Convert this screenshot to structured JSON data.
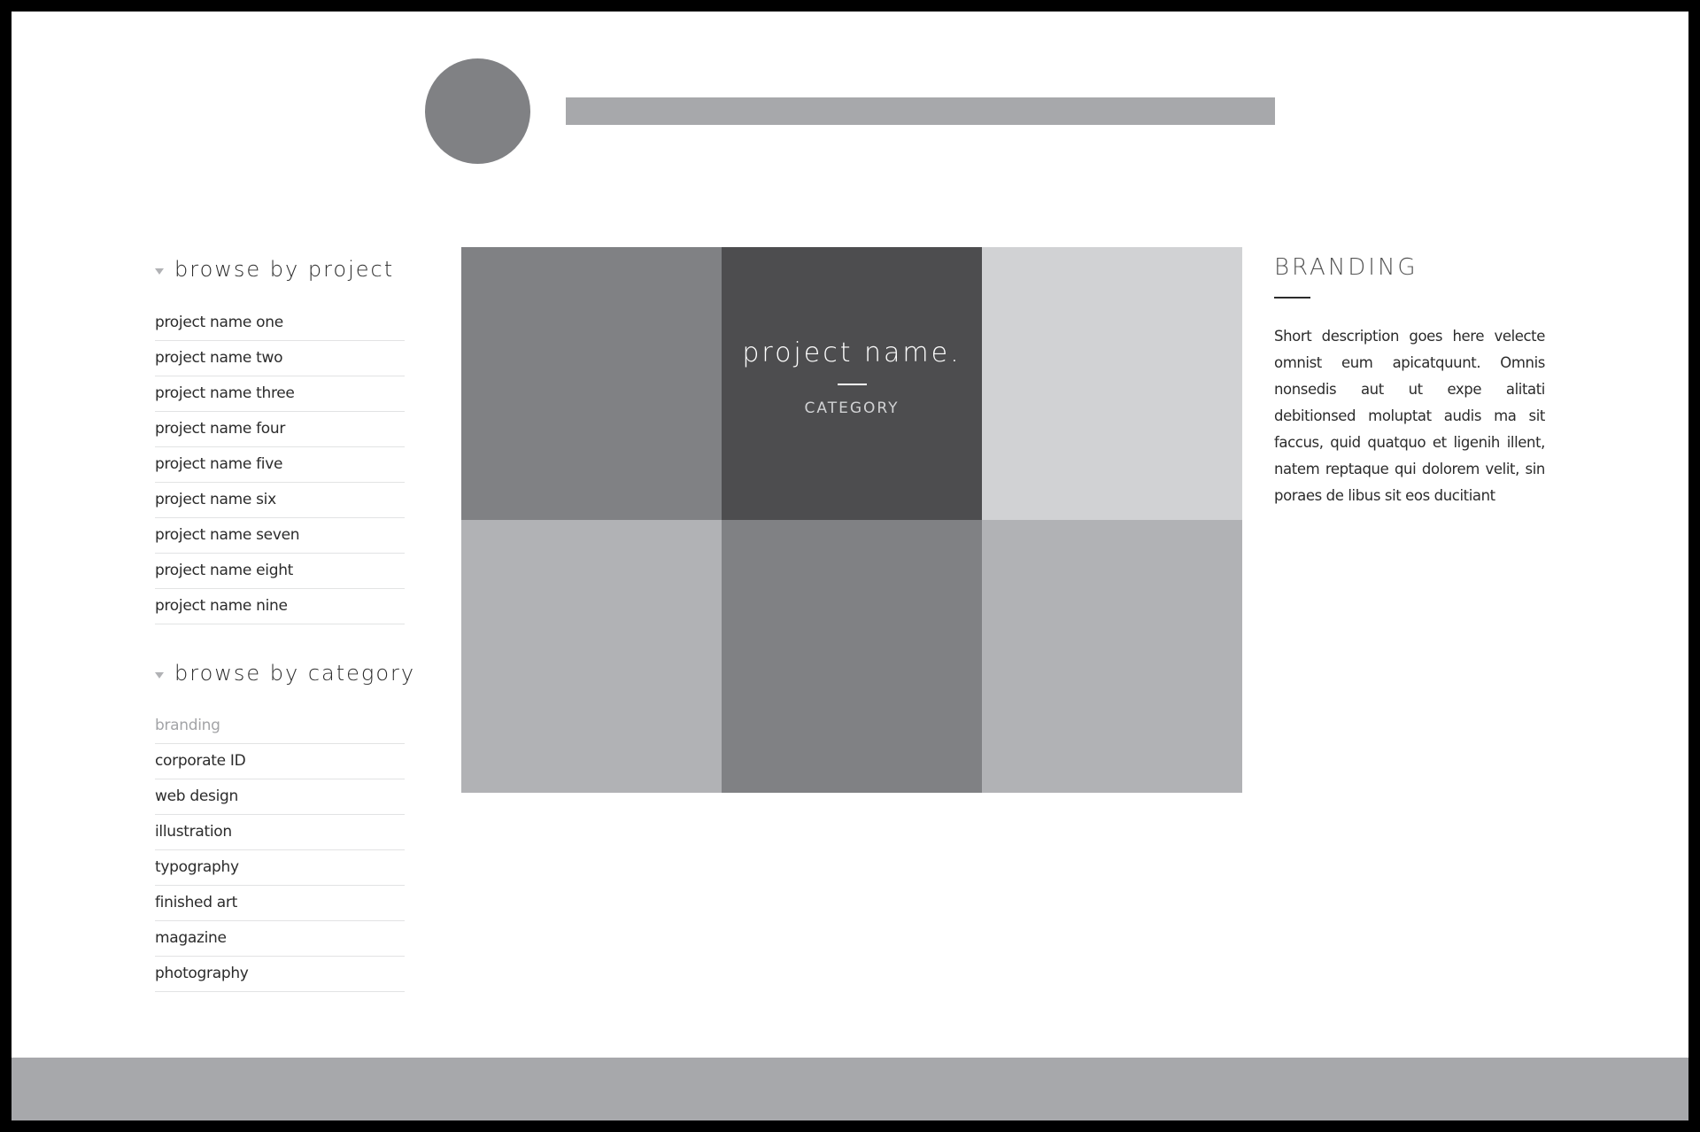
{
  "header": {
    "logo": "circle-logo-placeholder",
    "title_placeholder": "site-title-bar"
  },
  "sidebar": {
    "projects": {
      "heading": "browse by project",
      "items": [
        "project name one",
        "project name two",
        "project name three",
        "project name four",
        "project name five",
        "project name six",
        "project name seven",
        "project name eight",
        "project name nine"
      ]
    },
    "categories": {
      "heading": "browse by category",
      "active": "branding",
      "items": [
        "branding",
        "corporate ID",
        "web design",
        "illustration",
        "typography",
        "finished art",
        "magazine",
        "photography"
      ]
    }
  },
  "gallery": {
    "featured": {
      "name": "project name.",
      "category": "CATEGORY"
    },
    "tile_colors": [
      "#808184",
      "#4d4d4f",
      "#d1d2d4",
      "#b1b2b5",
      "#808184",
      "#b1b2b5"
    ]
  },
  "detail": {
    "heading": "BRANDING",
    "description": "Short description goes here velecte omnist eum apicatquunt. Omnis nonsedis aut ut expe alitati debitionsed moluptat audis ma sit faccus, quid quatquo et ligenih illent, natem reptaque qui dolorem velit, sin poraes de libus sit eos ducitiant"
  },
  "colors": {
    "frame": "#000000",
    "footer": "#a7a8ab",
    "text": "#2b2b2b",
    "muted": "#a3a4a7"
  }
}
